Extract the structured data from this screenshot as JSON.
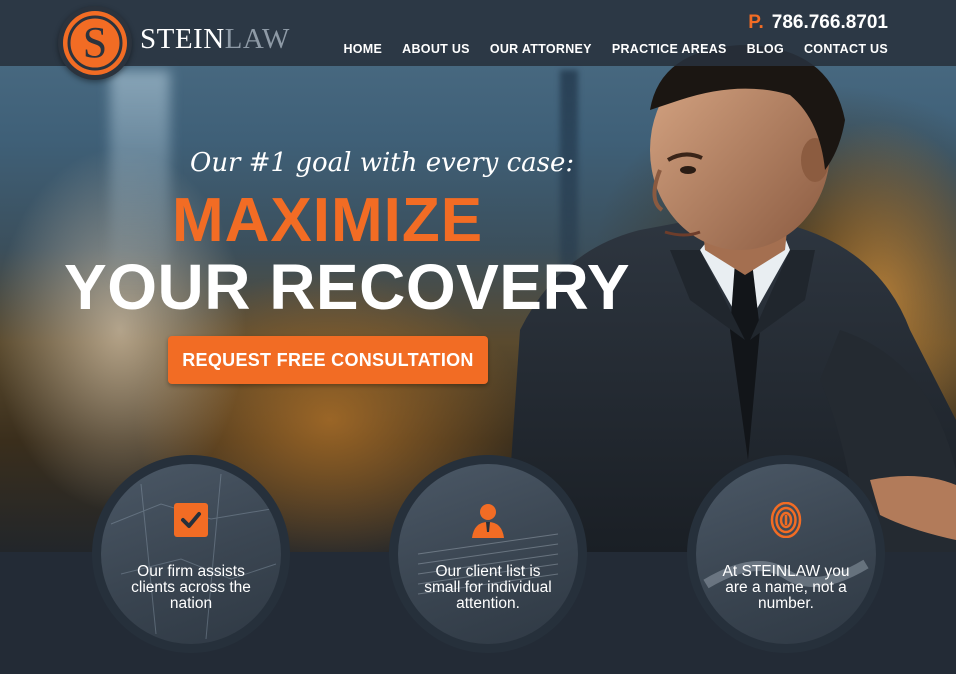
{
  "brand": {
    "logo_letter": "S",
    "name_part1": "STEIN",
    "name_part2": "LAW"
  },
  "contact": {
    "phone_prefix": "P.",
    "phone_number": "786.766.8701"
  },
  "nav": {
    "items": [
      "HOME",
      "ABOUT US",
      "OUR ATTORNEY",
      "PRACTICE AREAS",
      "BLOG",
      "CONTACT US"
    ]
  },
  "hero": {
    "tagline": "Our #1 goal with every case:",
    "headline_line1": "MAXIMIZE",
    "headline_line2": "YOUR RECOVERY",
    "cta_label": "REQUEST FREE CONSULTATION"
  },
  "features": [
    {
      "icon": "checkbox-icon",
      "text": "Our firm assists clients across the nation"
    },
    {
      "icon": "person-icon",
      "text": "Our client list is small for individual attention."
    },
    {
      "icon": "fingerprint-icon",
      "text": "At STEINLAW you are a name, not a number."
    }
  ],
  "colors": {
    "accent": "#f26c24",
    "header_bg": "#28313c",
    "band_bg": "#232b36",
    "text": "#ffffff",
    "logo_secondary": "#8e9aa6"
  }
}
